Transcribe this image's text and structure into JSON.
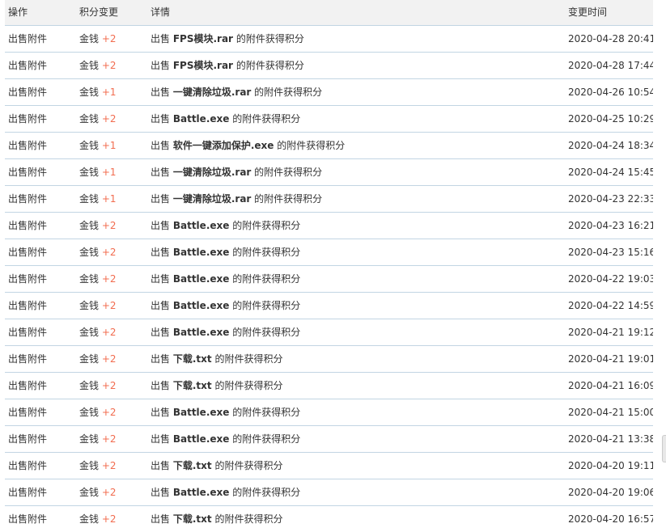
{
  "header": {
    "action": "操作",
    "points_change": "积分变更",
    "details": "详情",
    "change_time": "变更时间"
  },
  "rows": [
    {
      "action": "出售附件",
      "currency": "金钱",
      "points": "+2",
      "detail_prefix": "出售",
      "filename": "FPS模块.rar",
      "detail_suffix": "的附件获得积分",
      "time": "2020-04-28 20:41"
    },
    {
      "action": "出售附件",
      "currency": "金钱",
      "points": "+2",
      "detail_prefix": "出售",
      "filename": "FPS模块.rar",
      "detail_suffix": "的附件获得积分",
      "time": "2020-04-28 17:44"
    },
    {
      "action": "出售附件",
      "currency": "金钱",
      "points": "+1",
      "detail_prefix": "出售",
      "filename": "一键清除垃圾.rar",
      "detail_suffix": "的附件获得积分",
      "time": "2020-04-26 10:54"
    },
    {
      "action": "出售附件",
      "currency": "金钱",
      "points": "+2",
      "detail_prefix": "出售",
      "filename": "Battle.exe",
      "detail_suffix": "的附件获得积分",
      "time": "2020-04-25 10:29"
    },
    {
      "action": "出售附件",
      "currency": "金钱",
      "points": "+1",
      "detail_prefix": "出售",
      "filename": "软件一键添加保护.exe",
      "detail_suffix": "的附件获得积分",
      "time": "2020-04-24 18:34"
    },
    {
      "action": "出售附件",
      "currency": "金钱",
      "points": "+1",
      "detail_prefix": "出售",
      "filename": "一键清除垃圾.rar",
      "detail_suffix": "的附件获得积分",
      "time": "2020-04-24 15:45"
    },
    {
      "action": "出售附件",
      "currency": "金钱",
      "points": "+1",
      "detail_prefix": "出售",
      "filename": "一键清除垃圾.rar",
      "detail_suffix": "的附件获得积分",
      "time": "2020-04-23 22:33"
    },
    {
      "action": "出售附件",
      "currency": "金钱",
      "points": "+2",
      "detail_prefix": "出售",
      "filename": "Battle.exe",
      "detail_suffix": "的附件获得积分",
      "time": "2020-04-23 16:21"
    },
    {
      "action": "出售附件",
      "currency": "金钱",
      "points": "+2",
      "detail_prefix": "出售",
      "filename": "Battle.exe",
      "detail_suffix": "的附件获得积分",
      "time": "2020-04-23 15:16"
    },
    {
      "action": "出售附件",
      "currency": "金钱",
      "points": "+2",
      "detail_prefix": "出售",
      "filename": "Battle.exe",
      "detail_suffix": "的附件获得积分",
      "time": "2020-04-22 19:03"
    },
    {
      "action": "出售附件",
      "currency": "金钱",
      "points": "+2",
      "detail_prefix": "出售",
      "filename": "Battle.exe",
      "detail_suffix": "的附件获得积分",
      "time": "2020-04-22 14:59"
    },
    {
      "action": "出售附件",
      "currency": "金钱",
      "points": "+2",
      "detail_prefix": "出售",
      "filename": "Battle.exe",
      "detail_suffix": "的附件获得积分",
      "time": "2020-04-21 19:12"
    },
    {
      "action": "出售附件",
      "currency": "金钱",
      "points": "+2",
      "detail_prefix": "出售",
      "filename": "下载.txt",
      "detail_suffix": "的附件获得积分",
      "time": "2020-04-21 19:01"
    },
    {
      "action": "出售附件",
      "currency": "金钱",
      "points": "+2",
      "detail_prefix": "出售",
      "filename": "下载.txt",
      "detail_suffix": "的附件获得积分",
      "time": "2020-04-21 16:09"
    },
    {
      "action": "出售附件",
      "currency": "金钱",
      "points": "+2",
      "detail_prefix": "出售",
      "filename": "Battle.exe",
      "detail_suffix": "的附件获得积分",
      "time": "2020-04-21 15:00"
    },
    {
      "action": "出售附件",
      "currency": "金钱",
      "points": "+2",
      "detail_prefix": "出售",
      "filename": "Battle.exe",
      "detail_suffix": "的附件获得积分",
      "time": "2020-04-21 13:38"
    },
    {
      "action": "出售附件",
      "currency": "金钱",
      "points": "+2",
      "detail_prefix": "出售",
      "filename": "下载.txt",
      "detail_suffix": "的附件获得积分",
      "time": "2020-04-20 19:11"
    },
    {
      "action": "出售附件",
      "currency": "金钱",
      "points": "+2",
      "detail_prefix": "出售",
      "filename": "Battle.exe",
      "detail_suffix": "的附件获得积分",
      "time": "2020-04-20 19:06"
    },
    {
      "action": "出售附件",
      "currency": "金钱",
      "points": "+2",
      "detail_prefix": "出售",
      "filename": "下载.txt",
      "detail_suffix": "的附件获得积分",
      "time": "2020-04-20 16:57"
    }
  ],
  "colors": {
    "header_bg": "#f2f2f2",
    "row_border": "#c2d5e3",
    "points_positive": "#f26c4f",
    "text": "#333333"
  }
}
